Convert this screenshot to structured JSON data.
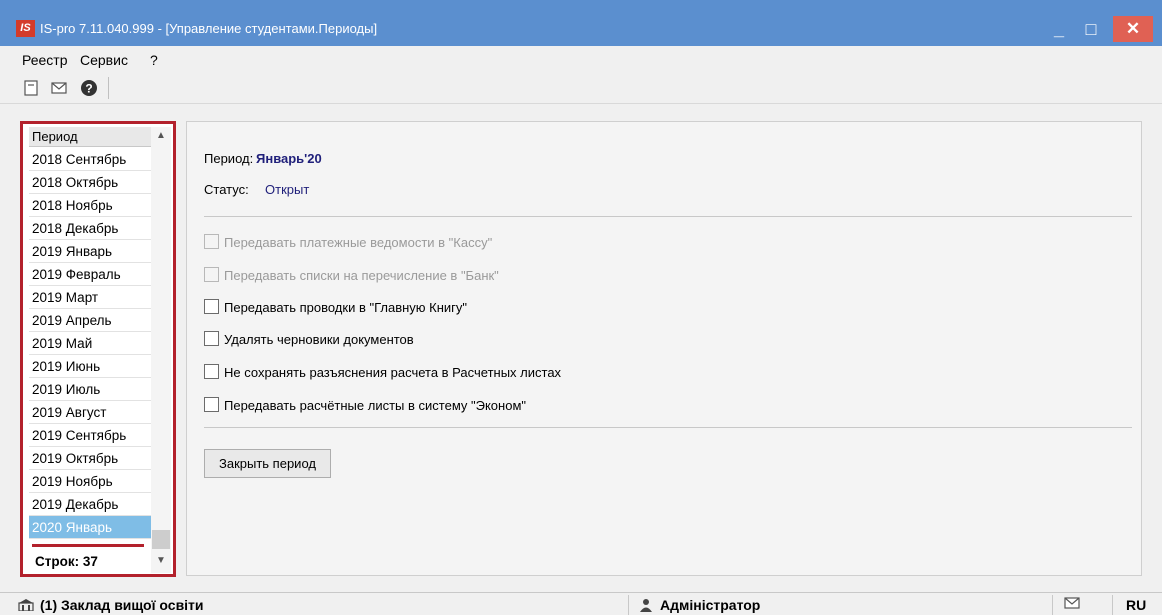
{
  "window": {
    "logo": "IS",
    "title": "IS-pro 7.11.040.999 - [Управление студентами.Периоды]",
    "minimize": "_",
    "maximize": "□",
    "close": "✕"
  },
  "menu": [
    "Реестр",
    "Сервис",
    "?"
  ],
  "toolbar": {
    "icons": [
      "form-icon",
      "envelope-icon",
      "help-icon"
    ]
  },
  "period_list": {
    "header": "Период",
    "rows": [
      "2018 Сентябрь",
      "2018 Октябрь",
      "2018 Ноябрь",
      "2018 Декабрь",
      "2019 Январь",
      "2019 Февраль",
      "2019 Март",
      "2019 Апрель",
      "2019 Май",
      "2019 Июнь",
      "2019 Июль",
      "2019 Август",
      "2019 Сентябрь",
      "2019 Октябрь",
      "2019 Ноябрь",
      "2019 Декабрь",
      "2020 Январь"
    ],
    "selected": "2020 Январь",
    "footer": "Строк: 37"
  },
  "annotation": "1",
  "details": {
    "period_label": "Период:",
    "period_value": "Январь'20",
    "status_label": "Статус:",
    "status_value": "Открыт",
    "options": [
      {
        "label": "Передавать платежные ведомости в \"Кассу\"",
        "checked": false,
        "disabled": true
      },
      {
        "label": "Передавать списки на перечисление в \"Банк\"",
        "checked": false,
        "disabled": true
      },
      {
        "label": "Передавать проводки в \"Главную Книгу\"",
        "checked": false,
        "disabled": false
      },
      {
        "label": "Удалять черновики документов",
        "checked": false,
        "disabled": false
      },
      {
        "label": "Не сохранять разъяснения расчета в Расчетных листах",
        "checked": false,
        "disabled": false
      },
      {
        "label": "Передавать расчётные листы в систему \"Эконом\"",
        "checked": false,
        "disabled": false
      }
    ],
    "close_button": "Закрыть период"
  },
  "statusbar": {
    "organization": "(1) Заклад вищої освіти",
    "user": "Адміністратор",
    "language": "RU"
  },
  "colors": {
    "titlebar": "#5b8fcf",
    "annotation": "#b3212c",
    "selection": "#7fbde6",
    "value_text": "#1f1f7a"
  }
}
